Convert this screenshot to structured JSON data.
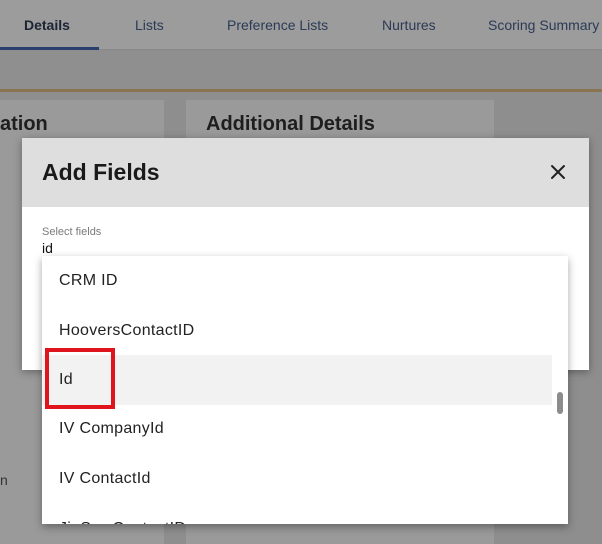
{
  "tabs": [
    {
      "label": "Details",
      "active": true
    },
    {
      "label": "Lists"
    },
    {
      "label": "Preference Lists"
    },
    {
      "label": "Nurtures"
    },
    {
      "label": "Scoring Summary"
    }
  ],
  "cards": {
    "left_title": "ation",
    "right_title": "Additional Details",
    "stray_text": "n"
  },
  "modal": {
    "title": "Add Fields",
    "close_icon": "close-icon",
    "field_label": "Select fields",
    "field_value": "id"
  },
  "dropdown": {
    "options": [
      {
        "label": "CRM ID"
      },
      {
        "label": "HooversContactID"
      },
      {
        "label": "Id",
        "highlighted": true
      },
      {
        "label": "IV CompanyId"
      },
      {
        "label": "IV ContactId"
      },
      {
        "label": "JigSawContactID"
      }
    ]
  },
  "colors": {
    "accent": "#2b3f6e",
    "highlight_box": "#e0141c"
  }
}
